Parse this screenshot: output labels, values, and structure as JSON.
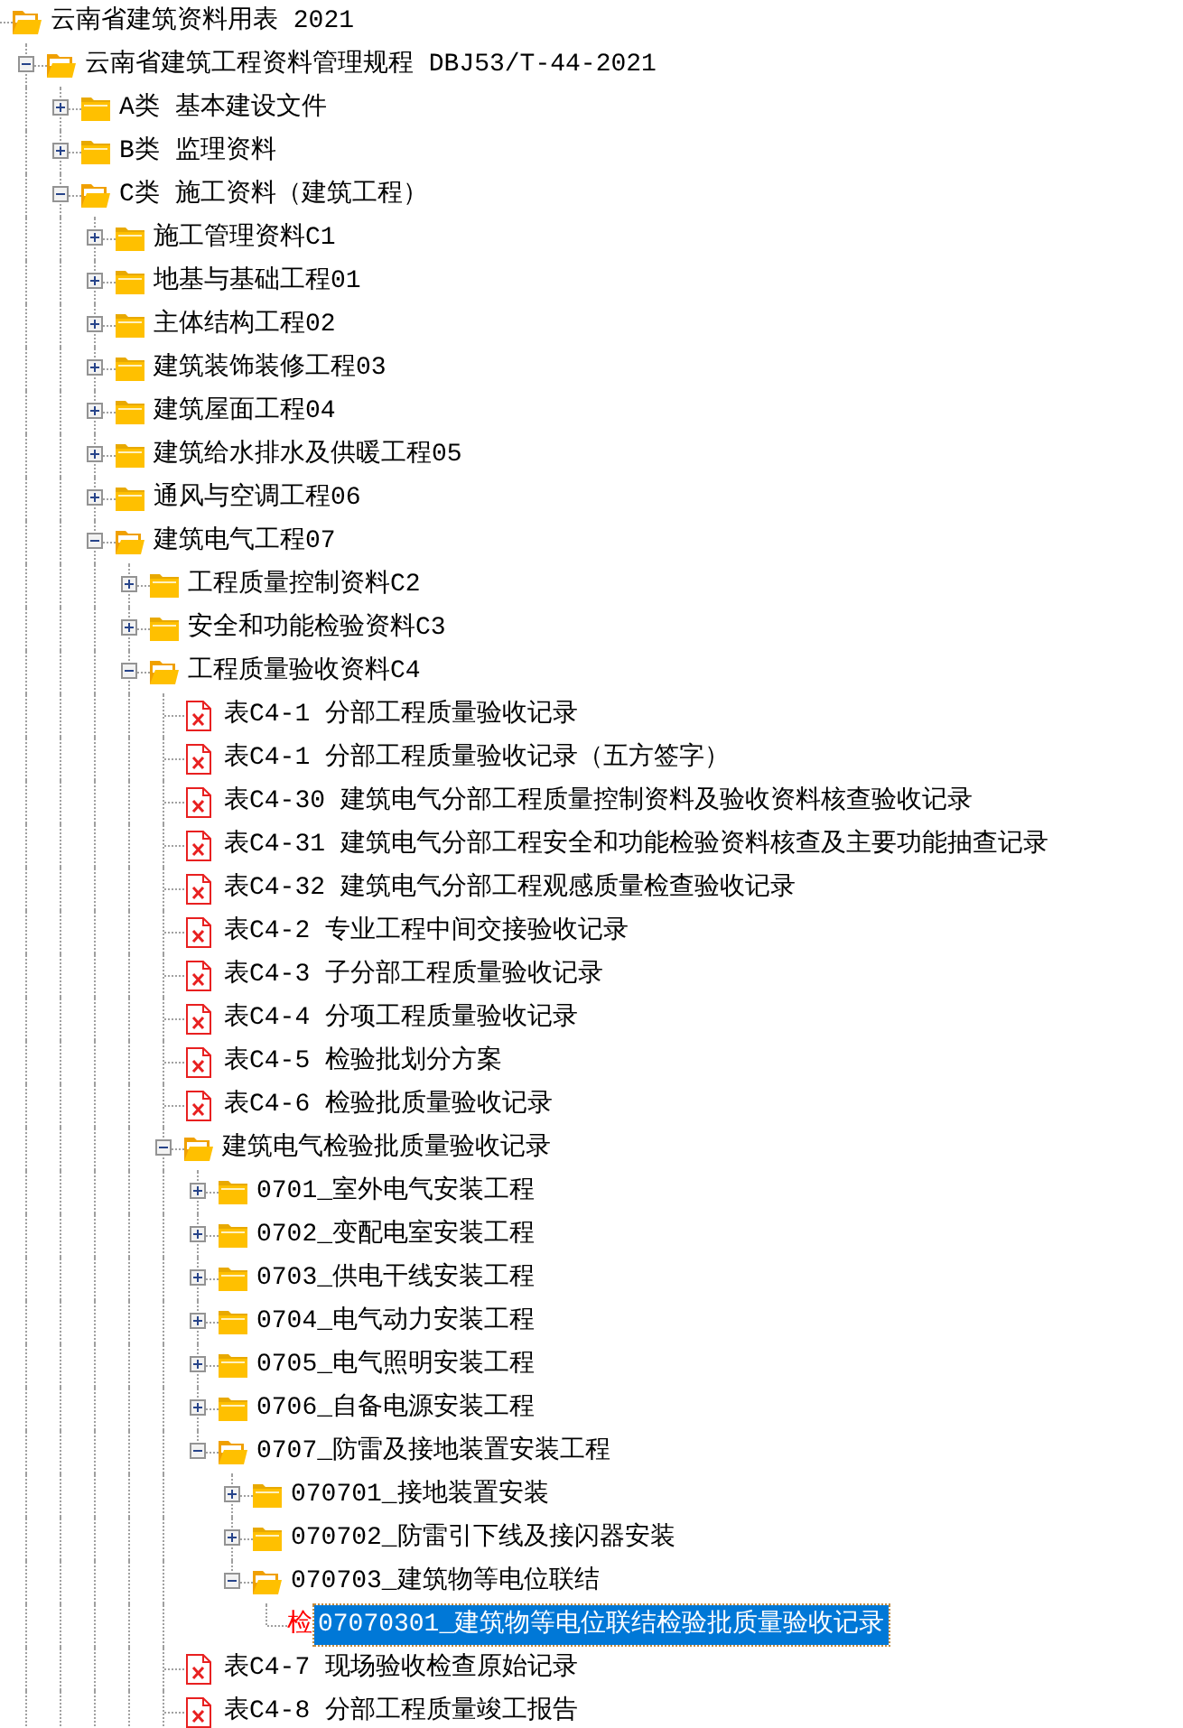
{
  "tree": [
    {
      "label": "云南省建筑资料用表 2021",
      "kind": "folder",
      "expanded": true,
      "selected": false,
      "children_continue": true,
      "children": [
        {
          "label": "云南省建筑工程资料管理规程 DBJ53/T-44-2021",
          "kind": "folder",
          "expanded": true,
          "selected": false,
          "children_continue": true,
          "children": [
            {
              "label": "A类 基本建设文件",
              "kind": "folder",
              "expanded": false,
              "selected": false
            },
            {
              "label": "B类 监理资料",
              "kind": "folder",
              "expanded": false,
              "selected": false
            },
            {
              "label": "C类 施工资料（建筑工程）",
              "kind": "folder",
              "expanded": true,
              "selected": false,
              "children_continue": true,
              "children": [
                {
                  "label": "施工管理资料C1",
                  "kind": "folder",
                  "expanded": false,
                  "selected": false
                },
                {
                  "label": "地基与基础工程01",
                  "kind": "folder",
                  "expanded": false,
                  "selected": false
                },
                {
                  "label": "主体结构工程02",
                  "kind": "folder",
                  "expanded": false,
                  "selected": false
                },
                {
                  "label": "建筑装饰装修工程03",
                  "kind": "folder",
                  "expanded": false,
                  "selected": false
                },
                {
                  "label": "建筑屋面工程04",
                  "kind": "folder",
                  "expanded": false,
                  "selected": false
                },
                {
                  "label": "建筑给水排水及供暖工程05",
                  "kind": "folder",
                  "expanded": false,
                  "selected": false
                },
                {
                  "label": "通风与空调工程06",
                  "kind": "folder",
                  "expanded": false,
                  "selected": false
                },
                {
                  "label": "建筑电气工程07",
                  "kind": "folder",
                  "expanded": true,
                  "selected": false,
                  "children_continue": true,
                  "children": [
                    {
                      "label": "工程质量控制资料C2",
                      "kind": "folder",
                      "expanded": false,
                      "selected": false
                    },
                    {
                      "label": "安全和功能检验资料C3",
                      "kind": "folder",
                      "expanded": false,
                      "selected": false
                    },
                    {
                      "label": "工程质量验收资料C4",
                      "kind": "folder",
                      "expanded": true,
                      "selected": false,
                      "children_continue": true,
                      "children": [
                        {
                          "label": "表C4-1 分部工程质量验收记录",
                          "kind": "file",
                          "selected": false
                        },
                        {
                          "label": "表C4-1 分部工程质量验收记录（五方签字）",
                          "kind": "file",
                          "selected": false
                        },
                        {
                          "label": "表C4-30 建筑电气分部工程质量控制资料及验收资料核查验收记录",
                          "kind": "file",
                          "selected": false
                        },
                        {
                          "label": "表C4-31 建筑电气分部工程安全和功能检验资料核查及主要功能抽查记录",
                          "kind": "file",
                          "selected": false
                        },
                        {
                          "label": "表C4-32 建筑电气分部工程观感质量检查验收记录",
                          "kind": "file",
                          "selected": false
                        },
                        {
                          "label": "表C4-2 专业工程中间交接验收记录",
                          "kind": "file",
                          "selected": false
                        },
                        {
                          "label": "表C4-3 子分部工程质量验收记录",
                          "kind": "file",
                          "selected": false
                        },
                        {
                          "label": "表C4-4 分项工程质量验收记录",
                          "kind": "file",
                          "selected": false
                        },
                        {
                          "label": "表C4-5 检验批划分方案",
                          "kind": "file",
                          "selected": false
                        },
                        {
                          "label": "表C4-6 检验批质量验收记录",
                          "kind": "file",
                          "selected": false
                        },
                        {
                          "label": "建筑电气检验批质量验收记录",
                          "kind": "folder",
                          "expanded": true,
                          "selected": false,
                          "children": [
                            {
                              "label": "0701_室外电气安装工程",
                              "kind": "folder",
                              "expanded": false,
                              "selected": false
                            },
                            {
                              "label": "0702_变配电室安装工程",
                              "kind": "folder",
                              "expanded": false,
                              "selected": false
                            },
                            {
                              "label": "0703_供电干线安装工程",
                              "kind": "folder",
                              "expanded": false,
                              "selected": false
                            },
                            {
                              "label": "0704_电气动力安装工程",
                              "kind": "folder",
                              "expanded": false,
                              "selected": false
                            },
                            {
                              "label": "0705_电气照明安装工程",
                              "kind": "folder",
                              "expanded": false,
                              "selected": false
                            },
                            {
                              "label": "0706_自备电源安装工程",
                              "kind": "folder",
                              "expanded": false,
                              "selected": false
                            },
                            {
                              "label": "0707_防雷及接地装置安装工程",
                              "kind": "folder",
                              "expanded": true,
                              "selected": false,
                              "children": [
                                {
                                  "label": "070701_接地装置安装",
                                  "kind": "folder",
                                  "expanded": false,
                                  "selected": false
                                },
                                {
                                  "label": "070702_防雷引下线及接闪器安装",
                                  "kind": "folder",
                                  "expanded": false,
                                  "selected": false
                                },
                                {
                                  "label": "070703_建筑物等电位联结",
                                  "kind": "folder",
                                  "expanded": true,
                                  "selected": false,
                                  "children": [
                                    {
                                      "label": "07070301_建筑物等电位联结检验批质量验收记录",
                                      "kind": "glyph",
                                      "glyph": "检",
                                      "selected": true
                                    }
                                  ]
                                }
                              ]
                            }
                          ]
                        },
                        {
                          "label": "表C4-7 现场验收检查原始记录",
                          "kind": "file",
                          "selected": false
                        },
                        {
                          "label": "表C4-8 分部工程质量竣工报告",
                          "kind": "file",
                          "selected": false
                        }
                      ]
                    }
                  ]
                }
              ]
            }
          ]
        }
      ]
    }
  ]
}
